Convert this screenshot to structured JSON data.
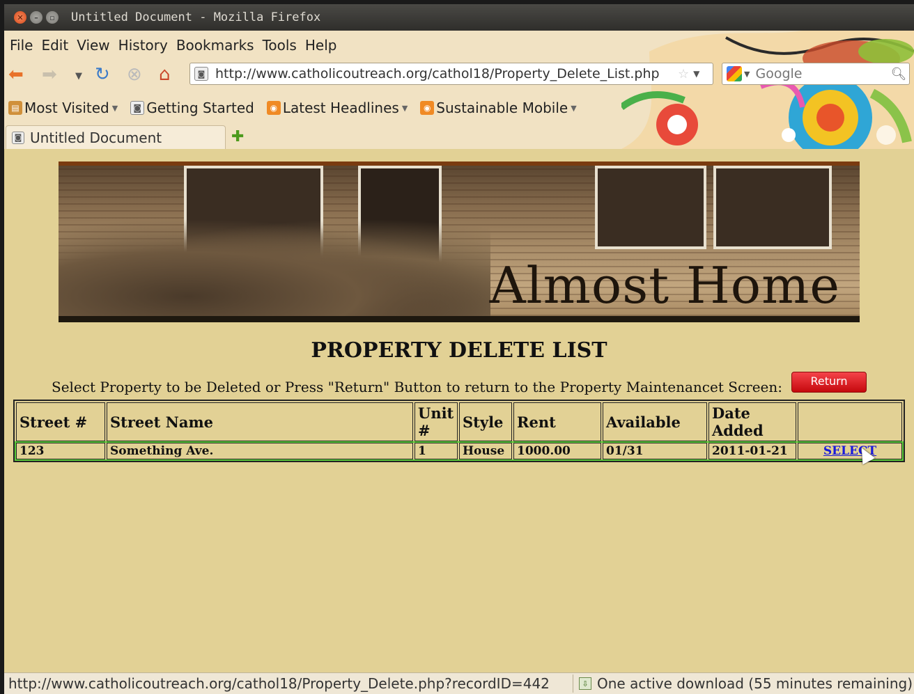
{
  "window": {
    "title": "Untitled Document - Mozilla Firefox"
  },
  "menubar": {
    "items": [
      "File",
      "Edit",
      "View",
      "History",
      "Bookmarks",
      "Tools",
      "Help"
    ]
  },
  "navbar": {
    "url": "http://www.catholicoutreach.org/cathol18/Property_Delete_List.php",
    "search_placeholder": "Google"
  },
  "bookmarks": {
    "items": [
      "Most Visited",
      "Getting Started",
      "Latest Headlines",
      "Sustainable Mobile"
    ]
  },
  "tabs": {
    "active": "Untitled Document"
  },
  "page": {
    "banner_text": "Almost Home",
    "title": "PROPERTY DELETE LIST",
    "instructions": "Select Property to be Deleted or Press \"Return\" Button to return to the Property Maintenancet Screen:",
    "return_label": "Return",
    "table": {
      "headers": [
        "Street #",
        "Street Name",
        "Unit #",
        "Style",
        "Rent",
        "Available",
        "Date Added",
        ""
      ],
      "rows": [
        {
          "street_no": "123",
          "street_name": "Something Ave.",
          "unit": "1",
          "style": "House",
          "rent": "1000.00",
          "available": "01/31",
          "date_added": "2011-01-21",
          "action": "SELECT"
        }
      ]
    }
  },
  "statusbar": {
    "link": "http://www.catholicoutreach.org/cathol18/Property_Delete.php?recordID=442",
    "download": "One active download (55 minutes remaining)"
  },
  "colors": {
    "page_background": "#e2d195",
    "return_button": "#d9141a",
    "select_link": "#1a1adb",
    "row_highlight": "#5ccc3a"
  }
}
